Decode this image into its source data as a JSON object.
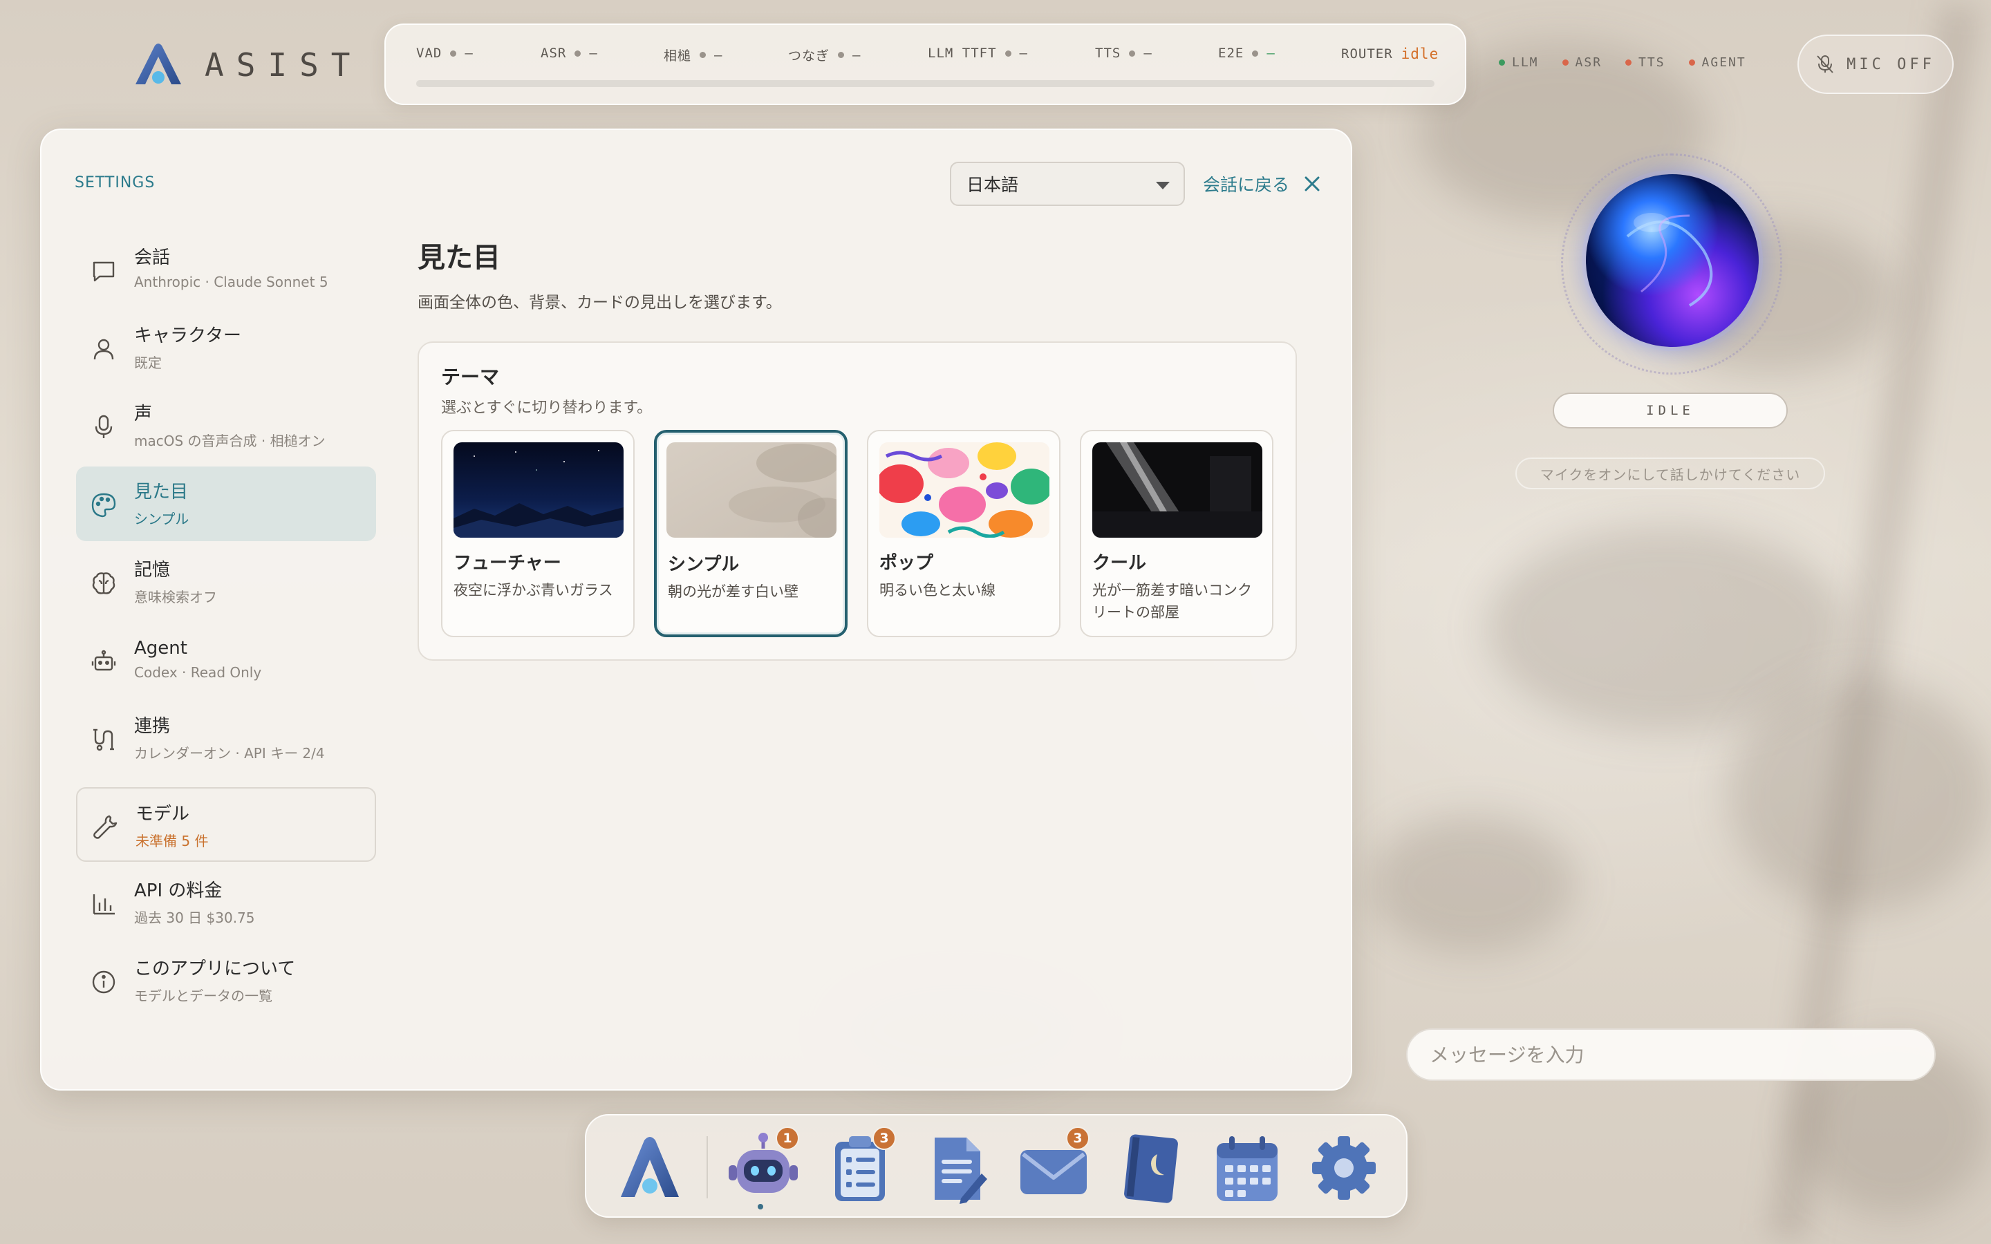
{
  "app": {
    "logo_text": "ASIST"
  },
  "metrics": [
    {
      "label": "VAD",
      "value": "—"
    },
    {
      "label": "ASR",
      "value": "—"
    },
    {
      "label": "相槌",
      "value": "—"
    },
    {
      "label": "つなぎ",
      "value": "—"
    },
    {
      "label": "LLM TTFT",
      "value": "—"
    },
    {
      "label": "TTS",
      "value": "—"
    },
    {
      "label": "E2E",
      "value": "—",
      "color": "#3c9a5f"
    }
  ],
  "router": {
    "label": "ROUTER",
    "value": "idle"
  },
  "status": [
    {
      "label": "LLM",
      "color": "#3c9a5f"
    },
    {
      "label": "ASR",
      "color": "#d9664a"
    },
    {
      "label": "TTS",
      "color": "#d9664a"
    },
    {
      "label": "AGENT",
      "color": "#d9664a"
    }
  ],
  "mic": {
    "label": "MIC OFF"
  },
  "settings": {
    "kicker": "SETTINGS",
    "language": "日本語",
    "back_label": "会話に戻る",
    "nav": [
      {
        "title": "会話",
        "sub": "Anthropic · Claude Sonnet 5",
        "icon": "chat-icon"
      },
      {
        "title": "キャラクター",
        "sub": "既定",
        "icon": "person-icon"
      },
      {
        "title": "声",
        "sub": "macOS の音声合成 · 相槌オン",
        "icon": "mic-icon"
      },
      {
        "title": "見た目",
        "sub": "シンプル",
        "icon": "palette-icon"
      },
      {
        "title": "記憶",
        "sub": "意味検索オフ",
        "icon": "brain-icon"
      },
      {
        "title": "Agent",
        "sub": "Codex · Read Only",
        "icon": "robot-icon"
      },
      {
        "title": "連携",
        "sub": "カレンダーオン · API キー 2/4",
        "icon": "link-icon"
      },
      {
        "title": "モデル",
        "sub": "未準備 5 件",
        "icon": "wrench-icon"
      },
      {
        "title": "API の料金",
        "sub": "過去 30 日 $30.75",
        "icon": "bar-chart-icon"
      },
      {
        "title": "このアプリについて",
        "sub": "モデルとデータの一覧",
        "icon": "info-icon"
      }
    ],
    "content": {
      "title": "見た目",
      "description": "画面全体の色、背景、カードの見出しを選びます。",
      "theme_section": {
        "title": "テーマ",
        "subtitle": "選ぶとすぐに切り替わります。",
        "themes": [
          {
            "name": "フューチャー",
            "desc": "夜空に浮かぶ青いガラス"
          },
          {
            "name": "シンプル",
            "desc": "朝の光が差す白い壁",
            "selected": true
          },
          {
            "name": "ポップ",
            "desc": "明るい色と太い線"
          },
          {
            "name": "クール",
            "desc": "光が一筋差す暗いコンクリートの部屋"
          }
        ]
      }
    }
  },
  "assistant": {
    "state": "IDLE",
    "hint": "マイクをオンにして話しかけてください"
  },
  "chat": {
    "placeholder": "メッセージを入力"
  },
  "dock": {
    "items": [
      {
        "name": "asist-app-icon"
      },
      {
        "name": "agent-robot-icon",
        "badge": "1"
      },
      {
        "name": "tasks-clipboard-icon",
        "badge": "3"
      },
      {
        "name": "notes-document-icon"
      },
      {
        "name": "mail-envelope-icon",
        "badge": "3"
      },
      {
        "name": "diary-book-icon"
      },
      {
        "name": "calendar-icon"
      },
      {
        "name": "settings-gear-icon"
      }
    ]
  }
}
